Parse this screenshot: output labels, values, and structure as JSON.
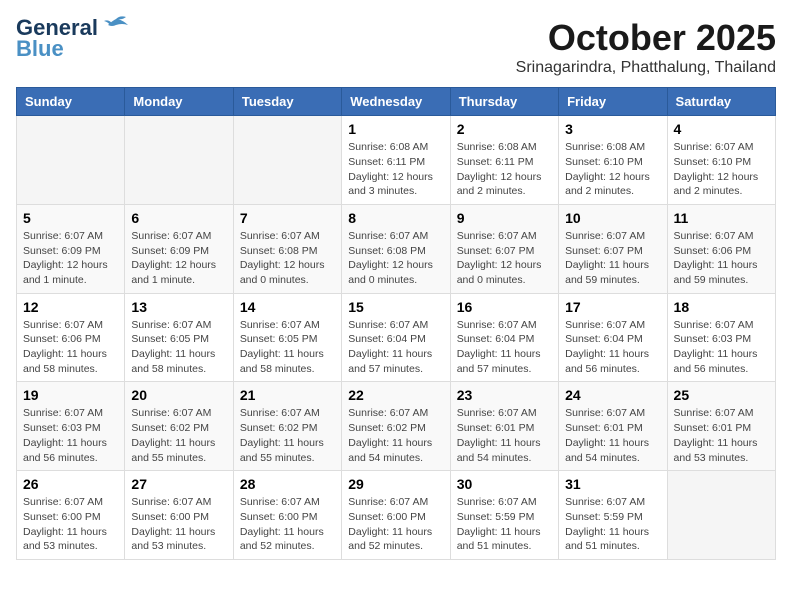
{
  "header": {
    "logo_line1": "General",
    "logo_line2": "Blue",
    "month": "October 2025",
    "location": "Srinagarindra, Phatthalung, Thailand"
  },
  "weekdays": [
    "Sunday",
    "Monday",
    "Tuesday",
    "Wednesday",
    "Thursday",
    "Friday",
    "Saturday"
  ],
  "weeks": [
    [
      {
        "day": "",
        "info": ""
      },
      {
        "day": "",
        "info": ""
      },
      {
        "day": "",
        "info": ""
      },
      {
        "day": "1",
        "info": "Sunrise: 6:08 AM\nSunset: 6:11 PM\nDaylight: 12 hours and 3 minutes."
      },
      {
        "day": "2",
        "info": "Sunrise: 6:08 AM\nSunset: 6:11 PM\nDaylight: 12 hours and 2 minutes."
      },
      {
        "day": "3",
        "info": "Sunrise: 6:08 AM\nSunset: 6:10 PM\nDaylight: 12 hours and 2 minutes."
      },
      {
        "day": "4",
        "info": "Sunrise: 6:07 AM\nSunset: 6:10 PM\nDaylight: 12 hours and 2 minutes."
      }
    ],
    [
      {
        "day": "5",
        "info": "Sunrise: 6:07 AM\nSunset: 6:09 PM\nDaylight: 12 hours and 1 minute."
      },
      {
        "day": "6",
        "info": "Sunrise: 6:07 AM\nSunset: 6:09 PM\nDaylight: 12 hours and 1 minute."
      },
      {
        "day": "7",
        "info": "Sunrise: 6:07 AM\nSunset: 6:08 PM\nDaylight: 12 hours and 0 minutes."
      },
      {
        "day": "8",
        "info": "Sunrise: 6:07 AM\nSunset: 6:08 PM\nDaylight: 12 hours and 0 minutes."
      },
      {
        "day": "9",
        "info": "Sunrise: 6:07 AM\nSunset: 6:07 PM\nDaylight: 12 hours and 0 minutes."
      },
      {
        "day": "10",
        "info": "Sunrise: 6:07 AM\nSunset: 6:07 PM\nDaylight: 11 hours and 59 minutes."
      },
      {
        "day": "11",
        "info": "Sunrise: 6:07 AM\nSunset: 6:06 PM\nDaylight: 11 hours and 59 minutes."
      }
    ],
    [
      {
        "day": "12",
        "info": "Sunrise: 6:07 AM\nSunset: 6:06 PM\nDaylight: 11 hours and 58 minutes."
      },
      {
        "day": "13",
        "info": "Sunrise: 6:07 AM\nSunset: 6:05 PM\nDaylight: 11 hours and 58 minutes."
      },
      {
        "day": "14",
        "info": "Sunrise: 6:07 AM\nSunset: 6:05 PM\nDaylight: 11 hours and 58 minutes."
      },
      {
        "day": "15",
        "info": "Sunrise: 6:07 AM\nSunset: 6:04 PM\nDaylight: 11 hours and 57 minutes."
      },
      {
        "day": "16",
        "info": "Sunrise: 6:07 AM\nSunset: 6:04 PM\nDaylight: 11 hours and 57 minutes."
      },
      {
        "day": "17",
        "info": "Sunrise: 6:07 AM\nSunset: 6:04 PM\nDaylight: 11 hours and 56 minutes."
      },
      {
        "day": "18",
        "info": "Sunrise: 6:07 AM\nSunset: 6:03 PM\nDaylight: 11 hours and 56 minutes."
      }
    ],
    [
      {
        "day": "19",
        "info": "Sunrise: 6:07 AM\nSunset: 6:03 PM\nDaylight: 11 hours and 56 minutes."
      },
      {
        "day": "20",
        "info": "Sunrise: 6:07 AM\nSunset: 6:02 PM\nDaylight: 11 hours and 55 minutes."
      },
      {
        "day": "21",
        "info": "Sunrise: 6:07 AM\nSunset: 6:02 PM\nDaylight: 11 hours and 55 minutes."
      },
      {
        "day": "22",
        "info": "Sunrise: 6:07 AM\nSunset: 6:02 PM\nDaylight: 11 hours and 54 minutes."
      },
      {
        "day": "23",
        "info": "Sunrise: 6:07 AM\nSunset: 6:01 PM\nDaylight: 11 hours and 54 minutes."
      },
      {
        "day": "24",
        "info": "Sunrise: 6:07 AM\nSunset: 6:01 PM\nDaylight: 11 hours and 54 minutes."
      },
      {
        "day": "25",
        "info": "Sunrise: 6:07 AM\nSunset: 6:01 PM\nDaylight: 11 hours and 53 minutes."
      }
    ],
    [
      {
        "day": "26",
        "info": "Sunrise: 6:07 AM\nSunset: 6:00 PM\nDaylight: 11 hours and 53 minutes."
      },
      {
        "day": "27",
        "info": "Sunrise: 6:07 AM\nSunset: 6:00 PM\nDaylight: 11 hours and 53 minutes."
      },
      {
        "day": "28",
        "info": "Sunrise: 6:07 AM\nSunset: 6:00 PM\nDaylight: 11 hours and 52 minutes."
      },
      {
        "day": "29",
        "info": "Sunrise: 6:07 AM\nSunset: 6:00 PM\nDaylight: 11 hours and 52 minutes."
      },
      {
        "day": "30",
        "info": "Sunrise: 6:07 AM\nSunset: 5:59 PM\nDaylight: 11 hours and 51 minutes."
      },
      {
        "day": "31",
        "info": "Sunrise: 6:07 AM\nSunset: 5:59 PM\nDaylight: 11 hours and 51 minutes."
      },
      {
        "day": "",
        "info": ""
      }
    ]
  ]
}
